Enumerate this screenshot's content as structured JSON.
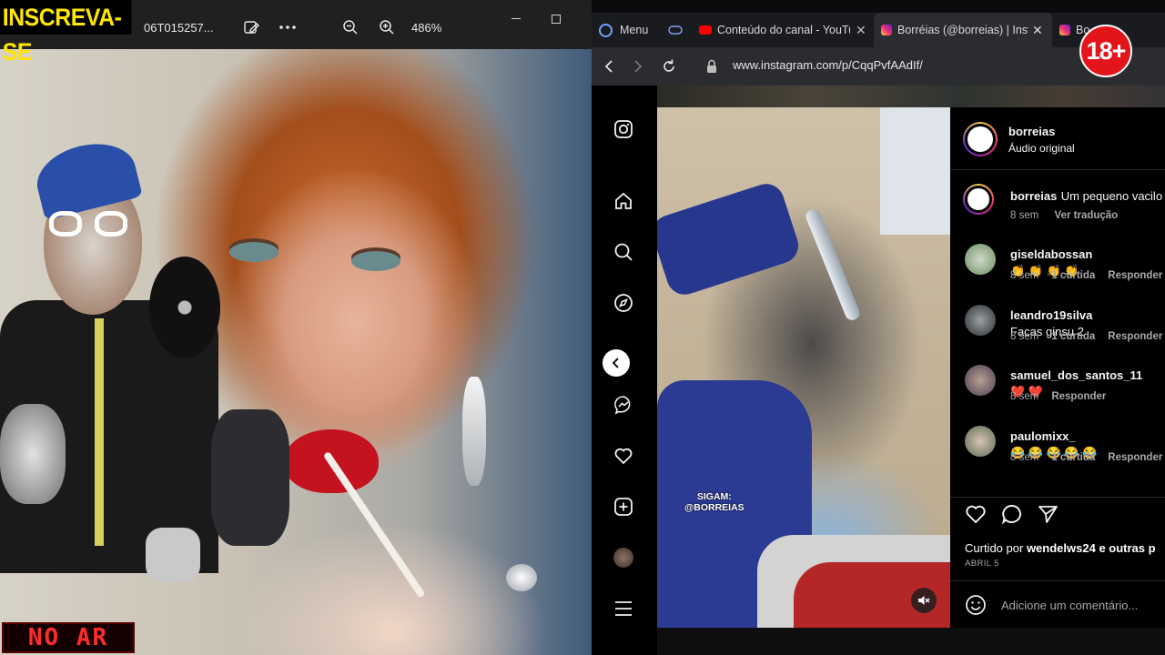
{
  "overlay": {
    "subscribe_banner": "INSCREVA-SE",
    "live_sign": "NO AR",
    "age_badge": "18+"
  },
  "viewer": {
    "filename": "06T015257...",
    "zoom": "486%"
  },
  "browser": {
    "menu_label": "Menu",
    "tabs": [
      {
        "label": "Conteúdo do canal - YouTu"
      },
      {
        "label": "Borréias (@borreias) | Insta"
      },
      {
        "label": "Bo"
      }
    ],
    "url": "www.instagram.com/p/CqqPvfAAdIf/"
  },
  "video": {
    "watermark_line1": "SIGAM:",
    "watermark_line2": "@BORREIAS"
  },
  "post": {
    "author": "borreias",
    "audio": "Áudio original",
    "caption_user": "borreias",
    "caption_text": "Um pequeno vacilo",
    "caption_age": "8 sem",
    "caption_translate": "Ver tradução",
    "comments": [
      {
        "user": "giseldabossan",
        "text": "👏 👏 👏 👏",
        "age": "8 sem",
        "likes": "1 curtida",
        "reply": "Responder"
      },
      {
        "user": "leandro19silva",
        "text": "Facas ginsu 2",
        "age": "8 sem",
        "likes": "1 curtida",
        "reply": "Responder"
      },
      {
        "user": "samuel_dos_santos_11",
        "text": "❤️ ❤️",
        "age": "8 sem",
        "likes": "",
        "reply": "Responder"
      },
      {
        "user": "paulomixx_",
        "text": "😂 😂 😂 😂 😂",
        "age": "8 sem",
        "likes": "1 curtida",
        "reply": "Responder"
      }
    ],
    "liked_by_prefix": "Curtido por",
    "liked_by_user": "wendelws24",
    "liked_by_suffix": "e outras p",
    "date": "ABRIL 5",
    "comment_placeholder": "Adicione um comentário..."
  }
}
